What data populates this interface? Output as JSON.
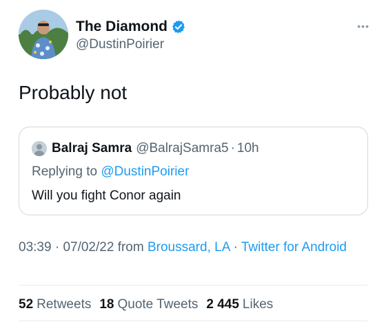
{
  "author": {
    "display_name": "The Diamond",
    "handle": "@DustinPoirier",
    "verified": true,
    "verified_color": "#1d9bf0"
  },
  "menu": {
    "more_icon": "more-horizontal-icon",
    "glyph": "•••"
  },
  "tweet": {
    "text": "Probably not"
  },
  "quoted_tweet": {
    "author_name": "Balraj Samra",
    "author_handle": "@BalrajSamra5",
    "separator": "·",
    "time": "10h",
    "replying_prefix": "Replying to",
    "replying_to": "@DustinPoirier",
    "text": "Will you fight Conor again"
  },
  "meta": {
    "time": "03:39",
    "separator": "·",
    "date": "07/02/22",
    "from_label": "from",
    "location": "Broussard, LA",
    "separator2": "·",
    "client": "Twitter for Android"
  },
  "stats": {
    "retweets_count": "52",
    "retweets_label": "Retweets",
    "quotes_count": "18",
    "quotes_label": "Quote Tweets",
    "likes_count": "2 445",
    "likes_label": "Likes"
  },
  "colors": {
    "text_primary": "#0f1419",
    "text_secondary": "#536471",
    "link": "#1d9bf0",
    "border": "#cfd9de"
  }
}
